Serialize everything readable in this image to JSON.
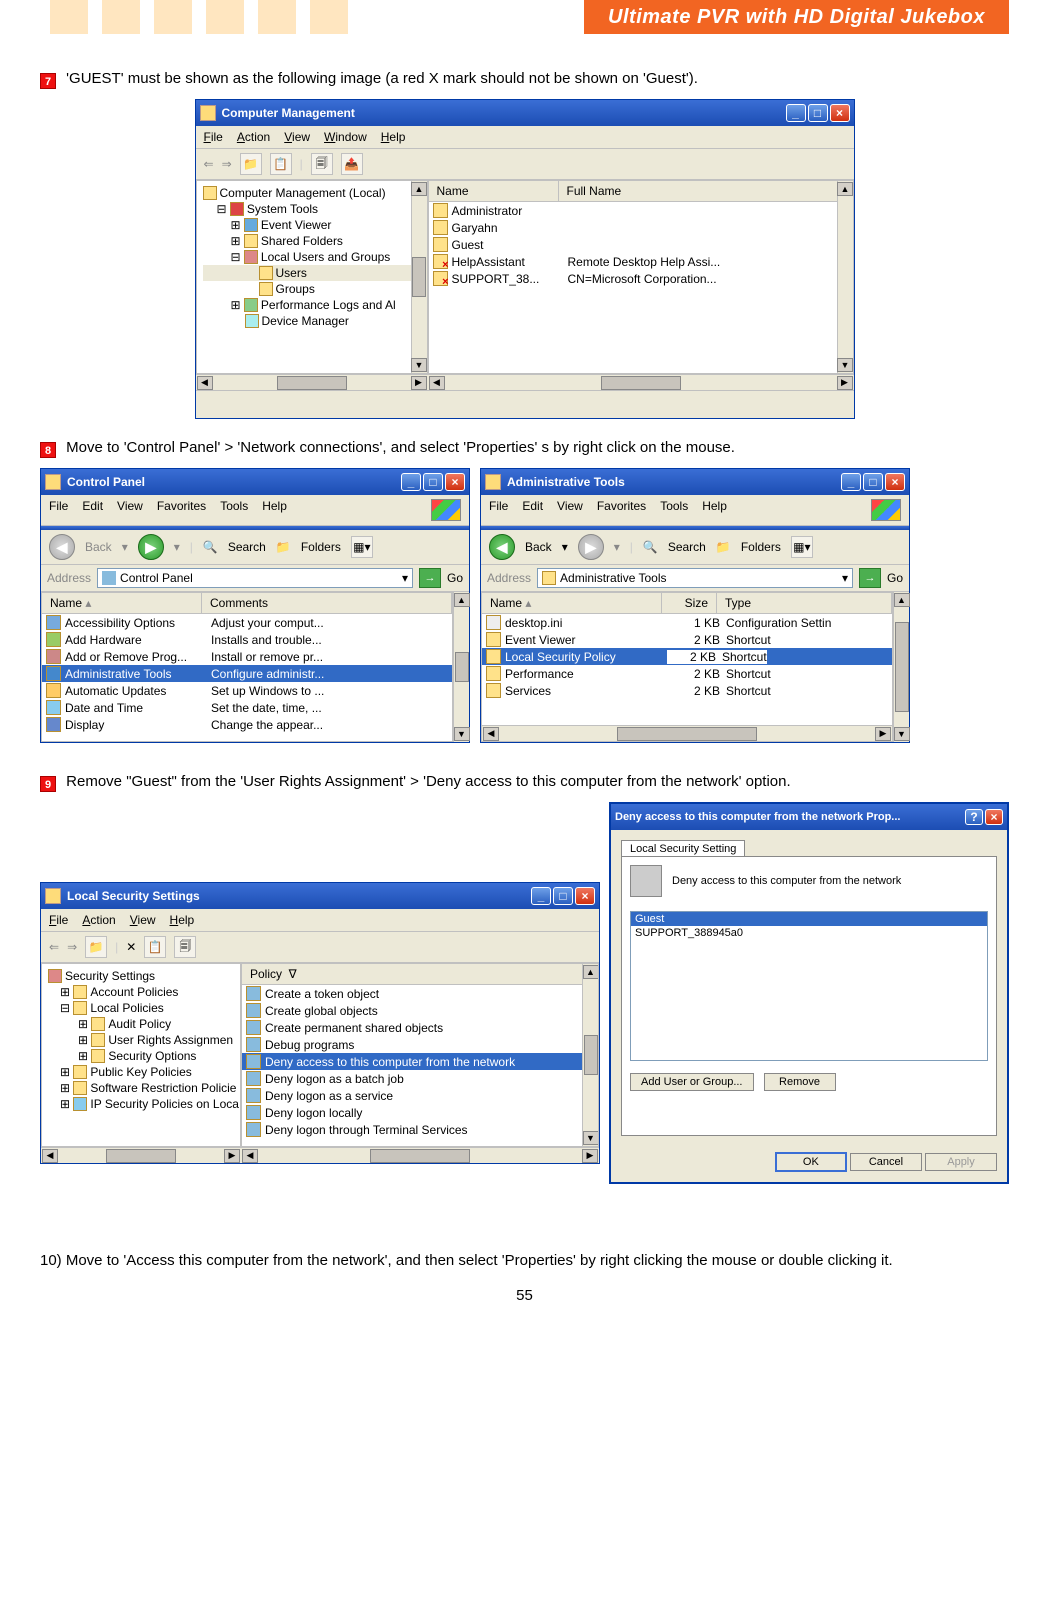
{
  "header": {
    "title": "Ultimate PVR with HD Digital Jukebox"
  },
  "steps": {
    "s7": {
      "num": "7",
      "text": "'GUEST' must be shown as the following image (a red X mark should not be shown on 'Guest')."
    },
    "s8": {
      "num": "8",
      "text": "Move to 'Control Panel' > 'Network connections', and select 'Properties' s by right click on the mouse."
    },
    "s9": {
      "num": "9",
      "text": "Remove \"Guest\" from the 'User Rights Assignment' > 'Deny access to this computer from the network' option."
    },
    "s10": {
      "text": "10) Move to 'Access this computer from the network', and then select 'Properties' by right clicking the mouse or double clicking it."
    }
  },
  "compmgmt": {
    "title": "Computer Management",
    "menus": [
      "File",
      "Action",
      "View",
      "Window",
      "Help"
    ],
    "tree": {
      "root": "Computer Management (Local)",
      "systools": "System Tools",
      "eventviewer": "Event Viewer",
      "sharedfolders": "Shared Folders",
      "localusers": "Local Users and Groups",
      "users": "Users",
      "groups": "Groups",
      "perflogs": "Performance Logs and Al",
      "devmgr": "Device Manager"
    },
    "list": {
      "cols": {
        "name": "Name",
        "fullname": "Full Name"
      },
      "rows": [
        {
          "name": "Administrator",
          "fullname": ""
        },
        {
          "name": "Garyahn",
          "fullname": ""
        },
        {
          "name": "Guest",
          "fullname": ""
        },
        {
          "name": "HelpAssistant",
          "fullname": "Remote Desktop Help Assi..."
        },
        {
          "name": "SUPPORT_38...",
          "fullname": "CN=Microsoft Corporation..."
        }
      ]
    }
  },
  "cp": {
    "title": "Control Panel",
    "menus": [
      "File",
      "Edit",
      "View",
      "Favorites",
      "Tools",
      "Help"
    ],
    "back": "Back",
    "search": "Search",
    "folders": "Folders",
    "addrlabel": "Address",
    "addr": "Control Panel",
    "go": "Go",
    "cols": {
      "name": "Name",
      "comments": "Comments"
    },
    "rows": [
      {
        "n": "Accessibility Options",
        "c": "Adjust your comput..."
      },
      {
        "n": "Add Hardware",
        "c": "Installs and trouble..."
      },
      {
        "n": "Add or Remove Prog...",
        "c": "Install or remove pr..."
      },
      {
        "n": "Administrative Tools",
        "c": "Configure administr...",
        "sel": true
      },
      {
        "n": "Automatic Updates",
        "c": "Set up Windows to ..."
      },
      {
        "n": "Date and Time",
        "c": "Set the date, time, ..."
      },
      {
        "n": "Display",
        "c": "Change the appear..."
      }
    ]
  },
  "at": {
    "title": "Administrative Tools",
    "menus": [
      "File",
      "Edit",
      "View",
      "Favorites",
      "Tools",
      "Help"
    ],
    "back": "Back",
    "search": "Search",
    "folders": "Folders",
    "addrlabel": "Address",
    "addr": "Administrative Tools",
    "go": "Go",
    "cols": {
      "name": "Name",
      "size": "Size",
      "type": "Type"
    },
    "rows": [
      {
        "n": "desktop.ini",
        "s": "1 KB",
        "t": "Configuration Settin"
      },
      {
        "n": "Event Viewer",
        "s": "2 KB",
        "t": "Shortcut"
      },
      {
        "n": "Local Security Policy",
        "s": "2 KB",
        "t": "Shortcut",
        "sel": true
      },
      {
        "n": "Performance",
        "s": "2 KB",
        "t": "Shortcut"
      },
      {
        "n": "Services",
        "s": "2 KB",
        "t": "Shortcut"
      }
    ]
  },
  "lss": {
    "title": "Local Security Settings",
    "menus": [
      "File",
      "Action",
      "View",
      "Help"
    ],
    "tree": [
      "Security Settings",
      "Account Policies",
      "Local Policies",
      "Audit Policy",
      "User Rights Assignmen",
      "Security Options",
      "Public Key Policies",
      "Software Restriction Policie",
      "IP Security Policies on Loca"
    ],
    "polcol": "Policy",
    "policies": [
      "Create a token object",
      "Create global objects",
      "Create permanent shared objects",
      "Debug programs",
      "Deny access to this computer from the network",
      "Deny logon as a batch job",
      "Deny logon as a service",
      "Deny logon locally",
      "Deny logon through Terminal Services"
    ],
    "sel": 4
  },
  "dlg": {
    "title": "Deny access to this computer from the network Prop...",
    "tab": "Local Security Setting",
    "label": "Deny access to this computer from the network",
    "list": [
      "Guest",
      "SUPPORT_388945a0"
    ],
    "sel": 0,
    "addbtn": "Add User or Group...",
    "removebtn": "Remove",
    "ok": "OK",
    "cancel": "Cancel",
    "apply": "Apply"
  },
  "pagenum": "55"
}
